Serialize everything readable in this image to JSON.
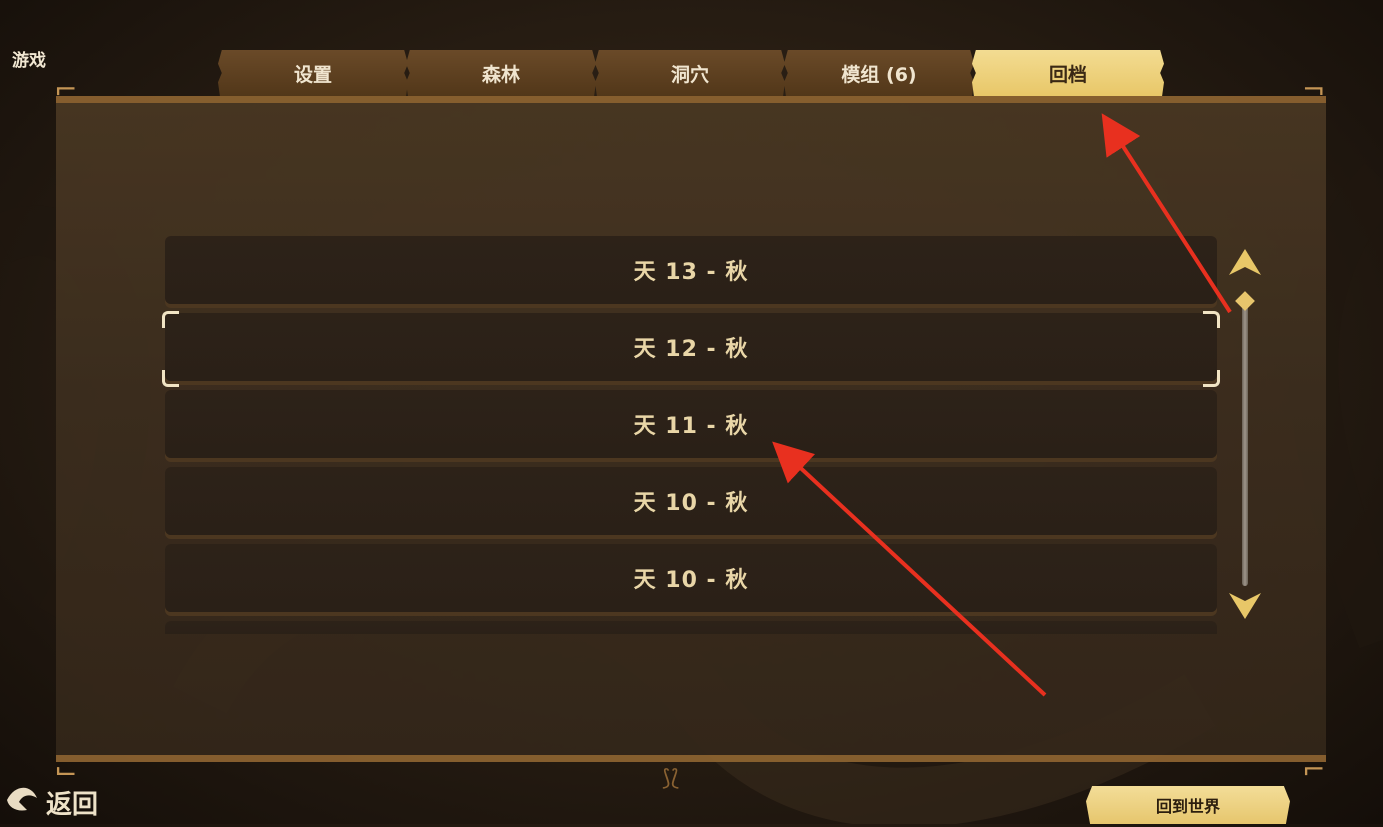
{
  "corner_title": "游戏",
  "tabs": [
    {
      "label": "设置",
      "active": false
    },
    {
      "label": "森林",
      "active": false
    },
    {
      "label": "洞穴",
      "active": false
    },
    {
      "label": "模组 (6)",
      "active": false
    },
    {
      "label": "回档",
      "active": true
    }
  ],
  "saves": [
    {
      "label": "天 13 - 秋",
      "selected": false
    },
    {
      "label": "天 12 - 秋",
      "selected": true
    },
    {
      "label": "天 11 - 秋",
      "selected": false
    },
    {
      "label": "天 10 - 秋",
      "selected": false
    },
    {
      "label": "天 10 - 秋",
      "selected": false
    }
  ],
  "back_label": "返回",
  "return_world_label": "回到世界",
  "colors": {
    "accent_gold": "#e8c768",
    "tab_brown": "#5c3f1e",
    "frame_bronze": "#8e6431",
    "annotation_red": "#e8301f"
  },
  "icons": {
    "scroll_up": "arrow-up-icon",
    "scroll_down": "arrow-down-icon",
    "back": "back-hand-icon"
  }
}
